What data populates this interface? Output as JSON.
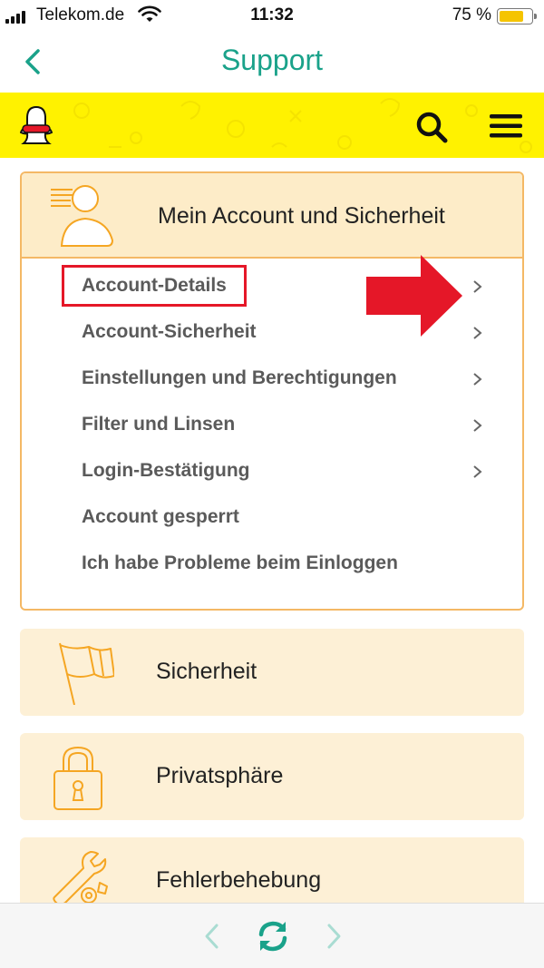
{
  "status_bar": {
    "carrier": "Telekom.de",
    "time": "11:32",
    "battery_percent": "75 %",
    "battery_level": 0.75
  },
  "nav": {
    "title": "Support"
  },
  "categories": {
    "expanded": {
      "title": "Mein Account und Sicherheit",
      "items": [
        {
          "label": "Account-Details",
          "has_chevron": true
        },
        {
          "label": "Account-Sicherheit",
          "has_chevron": true
        },
        {
          "label": "Einstellungen und Berechtigungen",
          "has_chevron": true
        },
        {
          "label": "Filter und Linsen",
          "has_chevron": true
        },
        {
          "label": "Login-Bestätigung",
          "has_chevron": true
        },
        {
          "label": "Account gesperrt",
          "has_chevron": false
        },
        {
          "label": "Ich habe Probleme beim Einloggen",
          "has_chevron": false
        }
      ]
    },
    "collapsed": [
      {
        "title": "Sicherheit",
        "icon": "flag-icon"
      },
      {
        "title": "Privatsphäre",
        "icon": "lock-icon"
      },
      {
        "title": "Fehlerbehebung",
        "icon": "wrench-icon"
      }
    ]
  },
  "colors": {
    "accent_teal": "#1aa28a",
    "header_yellow": "#fff200",
    "category_border": "#f4b865",
    "category_bg": "#fdecc8",
    "highlight_red": "#e51728"
  }
}
